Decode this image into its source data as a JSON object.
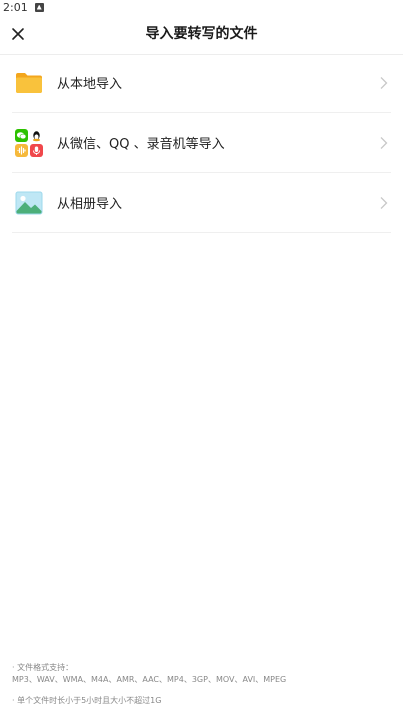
{
  "status_bar": {
    "time": "2:01"
  },
  "header": {
    "title": "导入要转写的文件"
  },
  "options": [
    {
      "label": "从本地导入",
      "icon": "folder-icon"
    },
    {
      "label": "从微信、QQ 、录音机等导入",
      "icon": "apps-grid-icon"
    },
    {
      "label": "从相册导入",
      "icon": "photo-album-icon"
    }
  ],
  "footer": {
    "formats_title": "· 文件格式支持：",
    "formats_list": "MP3、WAV、WMA、M4A、AMR、AAC、MP4、3GP、MOV、AVI、MPEG",
    "limit_note": "· 单个文件时长小于5小时且大小不超过1G"
  },
  "colors": {
    "folder": "#F7B82B",
    "wechat": "#2DC100",
    "audio": "#F6B93B",
    "mic": "#F0474B",
    "photo_sky": "#7FD0EE",
    "photo_hill": "#4CAF7A"
  }
}
